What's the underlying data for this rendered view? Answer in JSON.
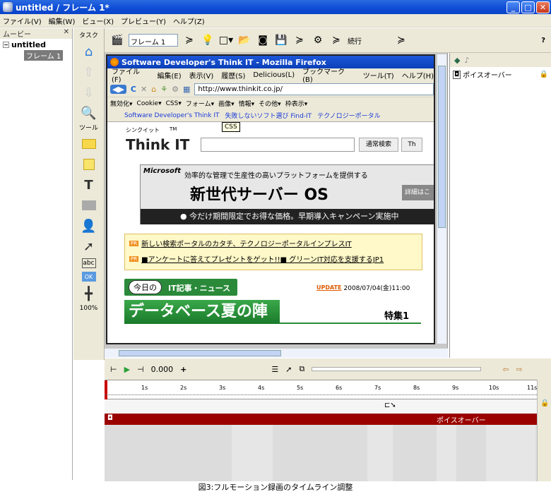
{
  "window": {
    "title": "untitled / フレーム 1*"
  },
  "menu": [
    "ファイル(V)",
    "編集(W)",
    "ビュー(X)",
    "プレビュー(Y)",
    "ヘルプ(Z)"
  ],
  "sidebar": {
    "title": "ムービー",
    "root": "untitled",
    "frame": "フレーム 1"
  },
  "tools": {
    "task_label": "タスク",
    "tool_label": "ツール",
    "zoom": "100%"
  },
  "toolbar": {
    "frame_select": "フレーム 1",
    "continue_label": "続行",
    "help": "?"
  },
  "firefox": {
    "title": "Software Developer's Think IT - Mozilla Firefox",
    "menu": [
      "ファイル(F)",
      "編集(E)",
      "表示(V)",
      "履歴(S)",
      "Delicious(L)",
      "ブックマーク(B)",
      "ツール(T)",
      "ヘルプ(H)"
    ],
    "url": "http://www.thinkit.co.jp/",
    "devbar": [
      "無効化▾",
      "Cookie▾",
      "CSS▾",
      "フォーム▾",
      "画像▾",
      "情報▾",
      "その他▾",
      "枠表示▾"
    ],
    "bookmarks": [
      "Software Developer's Think IT",
      "失敗しないソフト選び Find-IT",
      "テクノロジーポータル"
    ],
    "tooltip": "CSS"
  },
  "page": {
    "logo_small": "シンクイット",
    "logo_tm": "TM",
    "logo_text": "Think IT",
    "search_btn": "通常検索",
    "search_btn2": "Th",
    "ad_company": "Microsoft",
    "ad_line1": "効率的な管理で生産性の高いプラットフォームを提供する",
    "ad_line2": "新世代サーバー OS",
    "ad_more": "詳細はこ",
    "ad_bottom": "● 今だけ期間限定でお得な価格。早期導入キャンペーン実施中",
    "pr_badge": "PR",
    "pr1": "新しい検索ポータルのカタチ、テクノロジーポータルインプレスIT",
    "pr2": "■アンケートに答えてプレゼントをゲット!!■ グリーンIT対応を支援するJP1",
    "today": "今日の",
    "news_label": "IT記事・ニュース",
    "update_badge": "UPDATE",
    "update_date": "2008/07/04(金)11:00",
    "headline": "データベース夏の陣",
    "feature": "特集1"
  },
  "right_panel": {
    "item": "ポイスオーバー"
  },
  "timeline": {
    "time": "0.000",
    "ticks": [
      "1s",
      "2s",
      "3s",
      "4s",
      "5s",
      "6s",
      "7s",
      "8s",
      "9s",
      "10s",
      "11s"
    ],
    "track_label": "ポイスオーバー"
  },
  "caption": "図3:フルモーション録画のタイムライン調整"
}
